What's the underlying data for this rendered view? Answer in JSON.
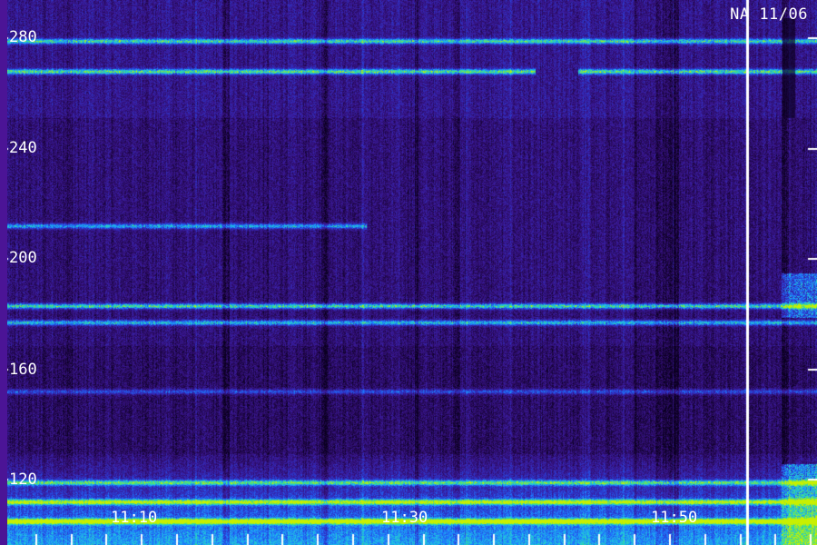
{
  "chart_data": {
    "type": "heatmap",
    "title": "NA 11/06",
    "xlabel": "",
    "ylabel": "",
    "x_tick_labels": [
      "11:10",
      "11:30",
      "11:50"
    ],
    "x_tick_values": [
      "11:10",
      "11:30",
      "11:50"
    ],
    "x_range": [
      "11:00",
      "11:58"
    ],
    "y_tick_labels": [
      "120",
      "160",
      "200",
      "240",
      "280"
    ],
    "y_tick_values": [
      120,
      160,
      200,
      240,
      280
    ],
    "y_range": [
      100,
      295
    ],
    "colormap": [
      "#0a0020",
      "#2a0a5e",
      "#3a1a9a",
      "#2a3ad0",
      "#1e7aff",
      "#20c8e0",
      "#40e080",
      "#c8f000"
    ],
    "background_color": "#1a0838",
    "marker_line": {
      "x": "11:53",
      "color": "#ffffff"
    },
    "bands": [
      {
        "freq": 279,
        "intensity": 0.55,
        "t_start": "11:00",
        "t_end": "11:58"
      },
      {
        "freq": 268,
        "intensity": 0.6,
        "t_start": "11:00",
        "t_end": "11:38"
      },
      {
        "freq": 268,
        "intensity": 0.6,
        "t_start": "11:41",
        "t_end": "11:58"
      },
      {
        "freq": 212,
        "intensity": 0.45,
        "t_start": "11:00",
        "t_end": "11:26"
      },
      {
        "freq": 183,
        "intensity": 0.6,
        "t_start": "11:00",
        "t_end": "11:58"
      },
      {
        "freq": 177,
        "intensity": 0.5,
        "t_start": "11:00",
        "t_end": "11:58"
      },
      {
        "freq": 152,
        "intensity": 0.3,
        "t_start": "11:00",
        "t_end": "11:58"
      },
      {
        "freq": 119,
        "intensity": 0.55,
        "t_start": "11:00",
        "t_end": "11:58"
      },
      {
        "freq": 112,
        "intensity": 0.7,
        "t_start": "11:00",
        "t_end": "11:58"
      },
      {
        "freq": 105,
        "intensity": 0.85,
        "t_start": "11:00",
        "t_end": "11:58"
      }
    ]
  }
}
